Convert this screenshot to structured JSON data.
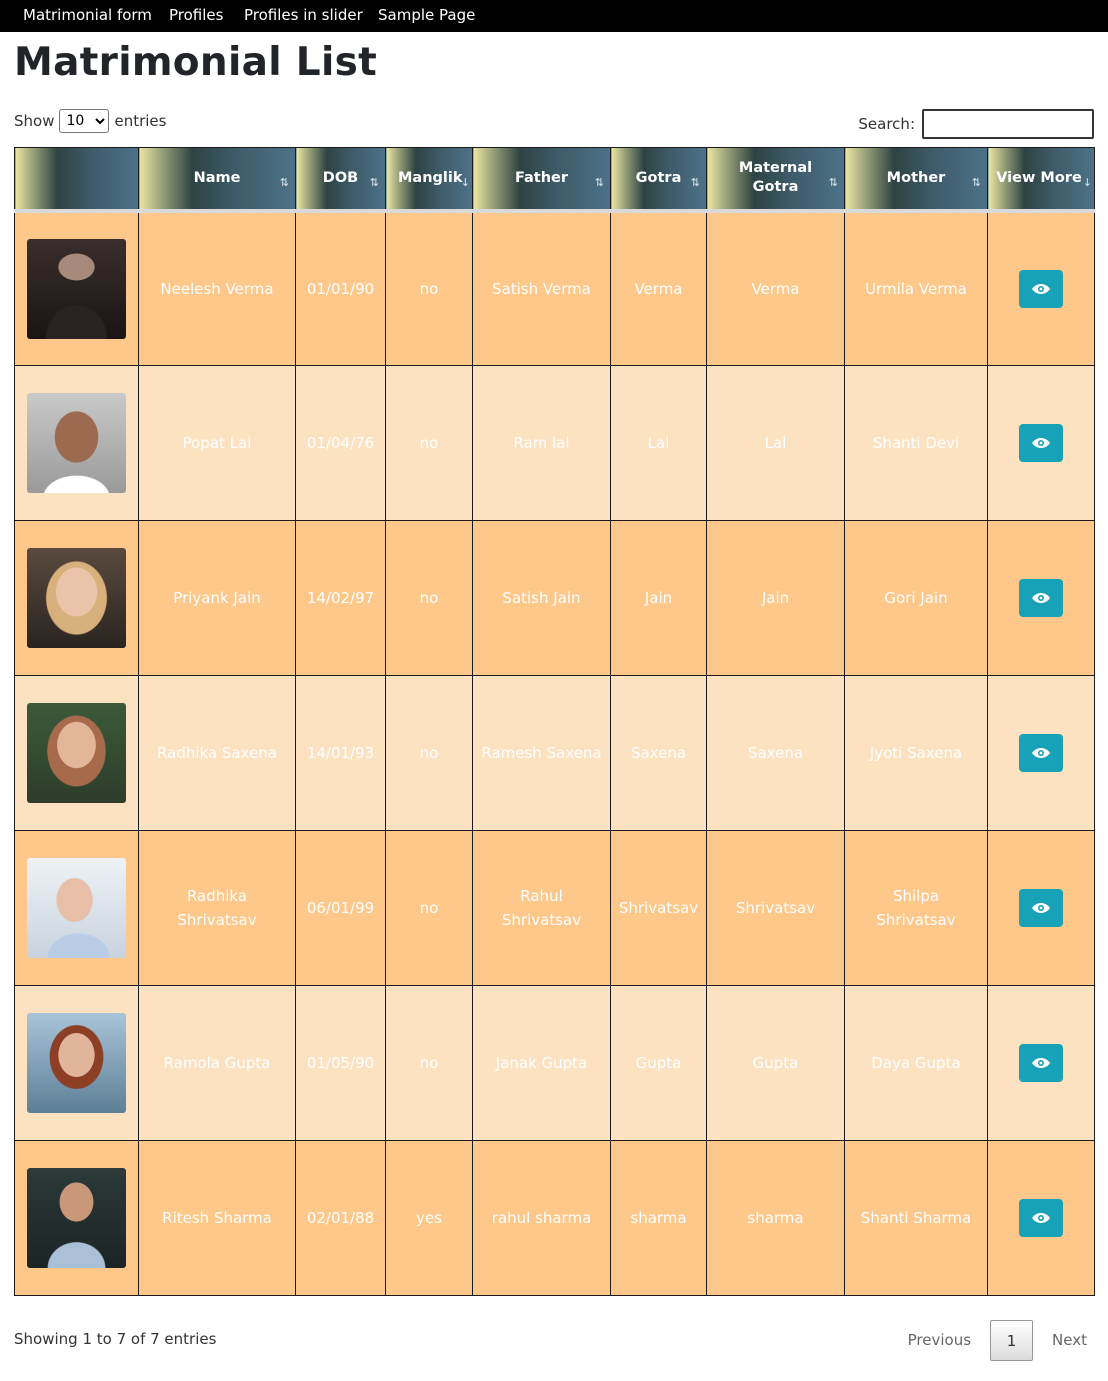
{
  "nav": {
    "items": [
      "Matrimonial form",
      "Profiles",
      "Profiles in slider",
      "Sample Page"
    ]
  },
  "page": {
    "title": "Matrimonial List"
  },
  "length": {
    "show": "Show",
    "value": "10",
    "options": [
      "10"
    ],
    "entries": "entries"
  },
  "search": {
    "label": "Search:",
    "value": ""
  },
  "table": {
    "headers": [
      "",
      "Name",
      "DOB",
      "Manglik",
      "Father",
      "Gotra",
      "Maternal Gotra",
      "Mother",
      "View More"
    ],
    "rows": [
      {
        "name": "Neelesh Verma",
        "dob": "01/01/90",
        "manglik": "no",
        "father": "Satish Verma",
        "gotra": "Verma",
        "maternal_gotra": "Verma",
        "mother": "Urmila Verma"
      },
      {
        "name": "Popat Lal",
        "dob": "01/04/76",
        "manglik": "no",
        "father": "Ram lal",
        "gotra": "Lal",
        "maternal_gotra": "Lal",
        "mother": "Shanti Devi"
      },
      {
        "name": "Priyank Jain",
        "dob": "14/02/97",
        "manglik": "no",
        "father": "Satish Jain",
        "gotra": "Jain",
        "maternal_gotra": "Jain",
        "mother": "Gori Jain"
      },
      {
        "name": "Radhika Saxena",
        "dob": "14/01/93",
        "manglik": "no",
        "father": "Ramesh Saxena",
        "gotra": "Saxena",
        "maternal_gotra": "Saxena",
        "mother": "Jyoti Saxena"
      },
      {
        "name": "Radhika Shrivatsav",
        "dob": "06/01/99",
        "manglik": "no",
        "father": "Rahul Shrivatsav",
        "gotra": "Shrivatsav",
        "maternal_gotra": "Shrivatsav",
        "mother": "Shilpa Shrivatsav"
      },
      {
        "name": "Ramola Gupta",
        "dob": "01/05/90",
        "manglik": "no",
        "father": "Janak Gupta",
        "gotra": "Gupta",
        "maternal_gotra": "Gupta",
        "mother": "Daya Gupta"
      },
      {
        "name": "Ritesh Sharma",
        "dob": "02/01/88",
        "manglik": "yes",
        "father": "rahul sharma",
        "gotra": "sharma",
        "maternal_gotra": "sharma",
        "mother": "Shanti Sharma"
      }
    ]
  },
  "info": "Showing 1 to 7 of 7 entries",
  "pagination": {
    "previous": "Previous",
    "current": "1",
    "next": "Next"
  },
  "colors": {
    "nav_bg": "#000000",
    "row_odd": "#fec88b",
    "row_even": "#fde2c2",
    "view_button": "#17a2b8"
  },
  "icons": {
    "view": "eye-icon",
    "sort": "sort-arrows-icon"
  }
}
